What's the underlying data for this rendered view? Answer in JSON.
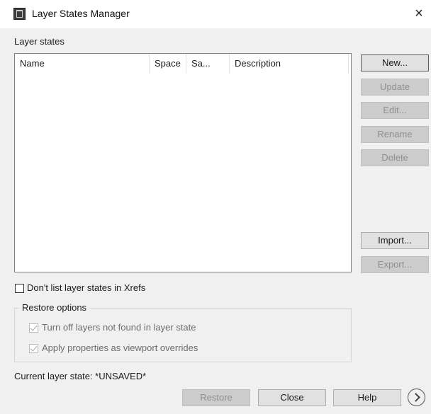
{
  "window": {
    "title": "Layer States Manager",
    "close_glyph": "×"
  },
  "layer_states": {
    "label": "Layer states",
    "columns": [
      "Name",
      "Space",
      "Sa...",
      "Description"
    ],
    "rows": []
  },
  "side_buttons": {
    "new": "New...",
    "update": "Update",
    "edit": "Edit...",
    "rename": "Rename",
    "delete": "Delete",
    "import": "Import...",
    "export": "Export..."
  },
  "xrefs_option": {
    "label": "Don't list layer states in Xrefs",
    "checked": false
  },
  "restore_options": {
    "title": "Restore options",
    "items": [
      {
        "label": "Turn off layers not found in layer state",
        "checked": true,
        "enabled": false
      },
      {
        "label": "Apply properties as viewport overrides",
        "checked": true,
        "enabled": false
      }
    ]
  },
  "current_state": {
    "text": "Current layer state: *UNSAVED*"
  },
  "bottom_buttons": {
    "restore": "Restore",
    "close": "Close",
    "help": "Help"
  },
  "icons": {
    "app": "autocad-app-icon",
    "close": "close-icon",
    "more": "chevron-right-circle-icon"
  }
}
